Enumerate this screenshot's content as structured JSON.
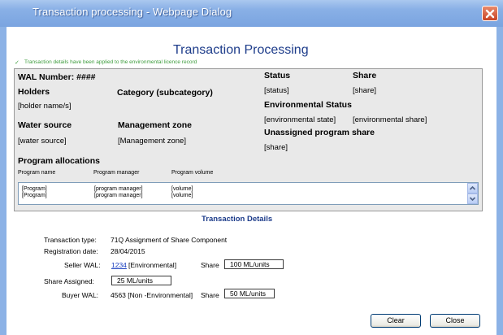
{
  "window": {
    "title": "Transaction processing - Webpage Dialog"
  },
  "page": {
    "title": "Transaction Processing",
    "confirmation_icon": "check-icon",
    "confirmation": "Transaction details have been applied to the environmental licence record"
  },
  "wal_panel": {
    "wal_number": "WAL Number: ####",
    "holders_label": "Holders",
    "holders_value": "[holder name/s]",
    "category_label": "Category (subcategory)",
    "water_source_label": "Water source",
    "water_source_value": "[water source]",
    "management_zone_label": "Management zone",
    "management_zone_value": "[Management zone]",
    "status_label": "Status",
    "status_value": "[status]",
    "share_label": "Share",
    "share_value": "[share]",
    "env_status_label": "Environmental Status",
    "env_state_value": "[environmental state]",
    "env_share_value": "[environmental share]",
    "unassigned_label": "Unassigned program share",
    "unassigned_value": "[share]",
    "program_allocations": {
      "title": "Program allocations",
      "columns": [
        "Program name",
        "Program manager",
        "Program volume"
      ],
      "rows": [
        [
          "[Program]",
          "[program manager]",
          "[volume]"
        ],
        [
          "[Program]",
          "[program manager]",
          "[volume]"
        ]
      ]
    }
  },
  "details": {
    "title": "Transaction Details",
    "transaction_type_label": "Transaction type:",
    "transaction_type_value": "71Q Assignment of Share Component",
    "registration_date_label": "Registration date:",
    "registration_date_value": "28/04/2015",
    "seller_wal_label": "Seller WAL:",
    "seller_wal_link": "1234",
    "seller_wal_type": "[Environmental]",
    "seller_share_label": "Share",
    "seller_share_value": "100 ML/units",
    "share_assigned_label": "Share Assigned:",
    "share_assigned_value": "25 ML/units",
    "buyer_wal_label": "Buyer WAL:",
    "buyer_wal_value": "4563 [Non -Environmental]",
    "buyer_share_label": "Share",
    "buyer_share_value": "50 ML/units"
  },
  "buttons": {
    "clear": "Clear",
    "close": "Close"
  },
  "colors": {
    "title_bar": "#89b0e6",
    "heading_blue": "#1d3c8a",
    "confirm_green": "#3b9b3b",
    "panel_bg": "#e9e9e9",
    "close_red": "#c84324"
  }
}
